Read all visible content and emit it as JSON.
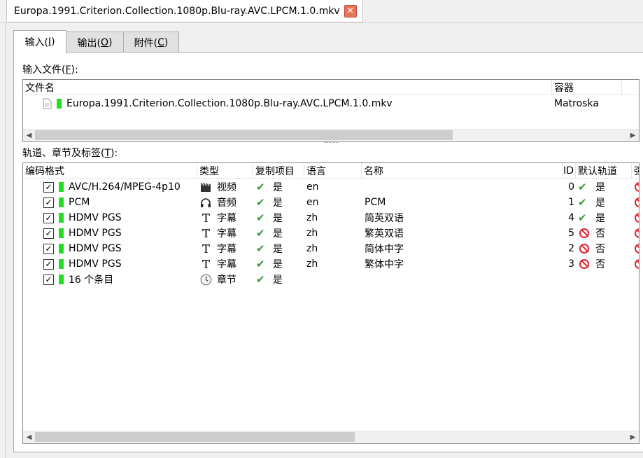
{
  "doc_tab": {
    "title": "Europa.1991.Criterion.Collection.1080p.Blu-ray.AVC.LPCM.1.0.mkv",
    "close": "✕"
  },
  "tabs": [
    {
      "label": "输入(",
      "key": "I",
      "tail": ")"
    },
    {
      "label": "输出(",
      "key": "O",
      "tail": ")"
    },
    {
      "label": "附件(",
      "key": "C",
      "tail": ")"
    }
  ],
  "input_files": {
    "label": "输入文件(",
    "key": "F",
    "tail": "):",
    "columns": [
      "文件名",
      "容器"
    ],
    "rows": [
      {
        "name": "Europa.1991.Criterion.Collection.1080p.Blu-ray.AVC.LPCM.1.0.mkv",
        "container": "Matroska"
      }
    ]
  },
  "tracks": {
    "label": "轨道、章节及标签(",
    "key": "T",
    "tail": "):",
    "columns": [
      "编码格式",
      "类型",
      "复制项目",
      "语言",
      "名称",
      "ID",
      "默认轨道",
      "强"
    ],
    "rows": [
      {
        "codec": "AVC/H.264/MPEG-4p10",
        "type_icon": "film-icon",
        "type": "视频",
        "copy": "是",
        "lang": "en",
        "name": "",
        "id": "0",
        "default_ok": true,
        "default": "是"
      },
      {
        "codec": "PCM",
        "type_icon": "headphones-icon",
        "type": "音频",
        "copy": "是",
        "lang": "en",
        "name": "PCM",
        "id": "1",
        "default_ok": true,
        "default": "是"
      },
      {
        "codec": "HDMV PGS",
        "type_icon": "text-icon",
        "type": "字幕",
        "copy": "是",
        "lang": "zh",
        "name": "简英双语",
        "id": "4",
        "default_ok": true,
        "default": "是"
      },
      {
        "codec": "HDMV PGS",
        "type_icon": "text-icon",
        "type": "字幕",
        "copy": "是",
        "lang": "zh",
        "name": "繁英双语",
        "id": "5",
        "default_ok": false,
        "default": "否"
      },
      {
        "codec": "HDMV PGS",
        "type_icon": "text-icon",
        "type": "字幕",
        "copy": "是",
        "lang": "zh",
        "name": "简体中字",
        "id": "2",
        "default_ok": false,
        "default": "否"
      },
      {
        "codec": "HDMV PGS",
        "type_icon": "text-icon",
        "type": "字幕",
        "copy": "是",
        "lang": "zh",
        "name": "繁体中字",
        "id": "3",
        "default_ok": false,
        "default": "否"
      },
      {
        "codec": "16 个条目",
        "type_icon": "clock-icon",
        "type": "章节",
        "copy": "是",
        "lang": "",
        "name": "",
        "id": "",
        "default_ok": null,
        "default": ""
      }
    ]
  }
}
